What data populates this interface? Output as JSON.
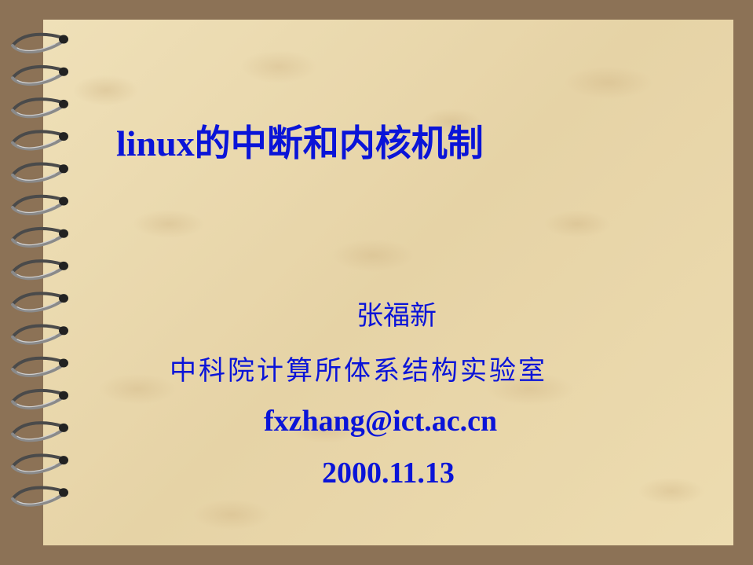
{
  "colors": {
    "text": "#0a14d8",
    "paper": "#ecdcb2",
    "background": "#8c7256",
    "spiral": "#6e6e6e",
    "hole": "#222222"
  },
  "slide": {
    "title": "linux的中断和内核机制",
    "author": "张福新",
    "affiliation": "中科院计算所体系结构实验室",
    "email": "fxzhang@ict.ac.cn",
    "date": "2000.11.13"
  },
  "binding": {
    "icon": "spiral-binding-icon",
    "ring_count": 15
  }
}
